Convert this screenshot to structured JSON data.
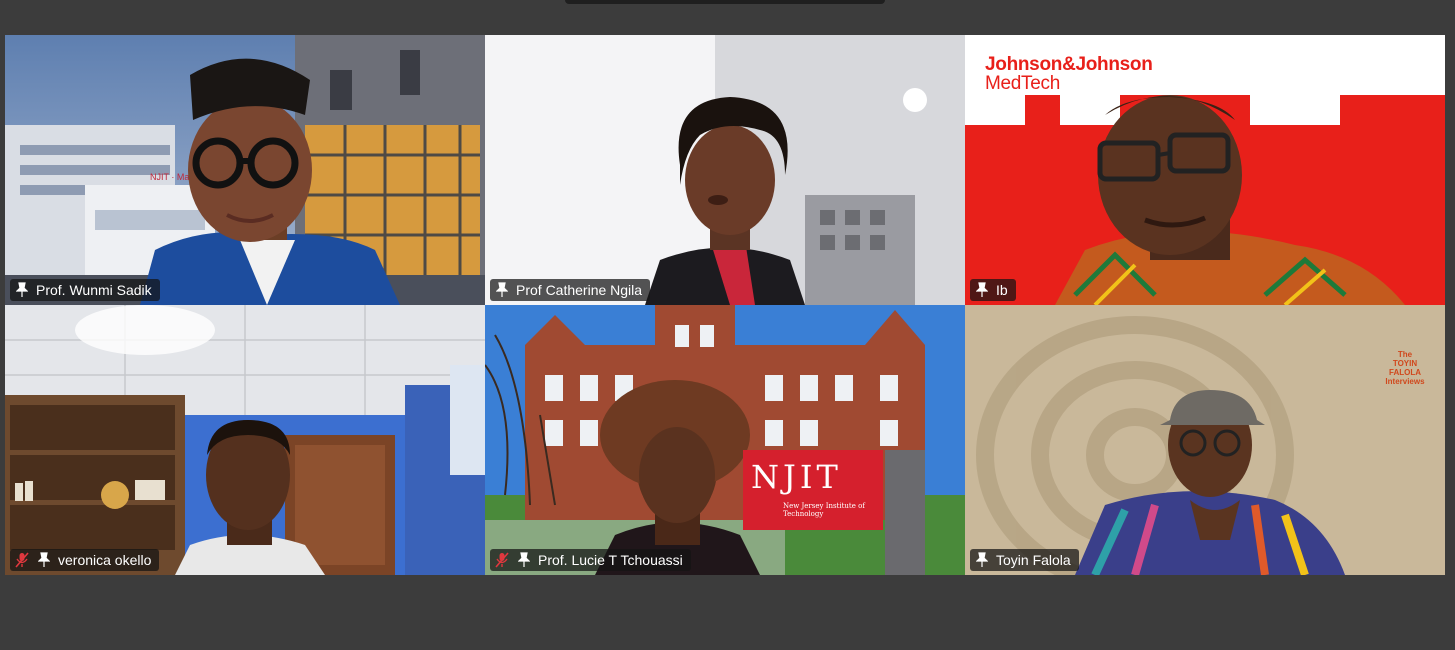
{
  "meeting": {
    "participants": [
      {
        "name": "Prof. Wunmi Sadik",
        "muted": false,
        "active_speaker": false,
        "icons": [
          "pin-icon"
        ]
      },
      {
        "name": "Prof Catherine Ngila",
        "muted": false,
        "active_speaker": true,
        "icons": [
          "pin-icon"
        ]
      },
      {
        "name": "Ib",
        "muted": false,
        "active_speaker": false,
        "icons": [
          "pin-icon"
        ]
      },
      {
        "name": "veronica okello",
        "muted": true,
        "active_speaker": false,
        "icons": [
          "mic-muted-icon",
          "pin-icon"
        ]
      },
      {
        "name": "Prof. Lucie T Tchouassi",
        "muted": true,
        "active_speaker": false,
        "icons": [
          "mic-muted-icon",
          "pin-icon"
        ]
      },
      {
        "name": "Toyin Falola",
        "muted": false,
        "active_speaker": false,
        "icons": [
          "pin-icon"
        ]
      }
    ]
  },
  "backgrounds": {
    "jj": {
      "line1": "Johnson&Johnson",
      "line2": "MedTech"
    },
    "njit": {
      "sign": "NJIT",
      "sign_sub": "New Jersey Institute of Technology",
      "building_sign": "NJIT · Makr"
    },
    "falola": {
      "brand": "The TOYIN FALOLA Interviews"
    }
  },
  "colors": {
    "window_bg": "#3c3c3c",
    "active_speaker_border": "#22e07a",
    "muted_icon": "#e0383e",
    "jj_red": "#e8201a"
  }
}
